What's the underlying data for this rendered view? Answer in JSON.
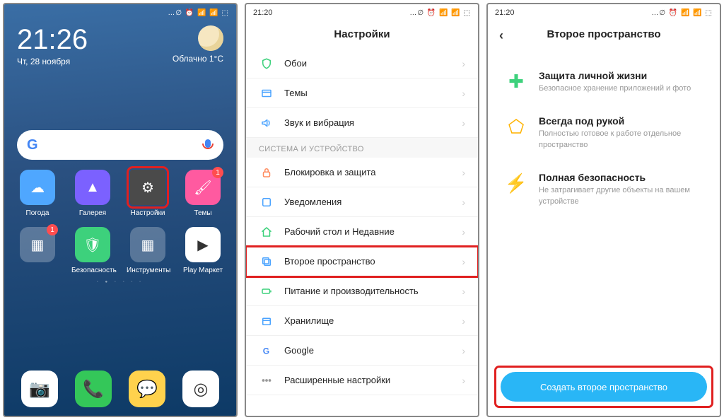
{
  "phone1": {
    "status": {
      "indicators": "…∅ ⏰ 📶 📶 ⬚"
    },
    "clock": {
      "time": "21:26",
      "date": "Чт, 28 ноября"
    },
    "weather": {
      "cond": "Облачно",
      "temp": "1°C"
    },
    "apps_row1": [
      {
        "name": "weather-app",
        "label": "Погода",
        "bg": "#4fa7ff",
        "glyph": "☁"
      },
      {
        "name": "gallery-app",
        "label": "Галерея",
        "bg": "#7b61ff",
        "glyph": "▲"
      },
      {
        "name": "settings-app",
        "label": "Настройки",
        "bg": "#4a4a4a",
        "glyph": "⚙",
        "highlight": true
      },
      {
        "name": "themes-app",
        "label": "Темы",
        "bg": "#ff5aa0",
        "glyph": "🖌",
        "badge": "1"
      }
    ],
    "apps_row2": [
      {
        "name": "tools-folder",
        "label": "",
        "bg": "rgba(255,255,255,.25)",
        "glyph": "▦",
        "badge": "1"
      },
      {
        "name": "security-app",
        "label": "Безопасность",
        "bg": "#3dd17c",
        "glyph": "🛡"
      },
      {
        "name": "instruments-folder",
        "label": "Инструменты",
        "bg": "rgba(255,255,255,.25)",
        "glyph": "▦"
      },
      {
        "name": "play-store-app",
        "label": "Play Маркет",
        "bg": "#ffffff",
        "glyph": "▶"
      }
    ],
    "dock": [
      {
        "name": "camera-app",
        "bg": "#fff",
        "glyph": "📷"
      },
      {
        "name": "phone-app",
        "bg": "#34c759",
        "glyph": "📞"
      },
      {
        "name": "messages-app",
        "bg": "#ffd24d",
        "glyph": "💬"
      },
      {
        "name": "chrome-app",
        "bg": "#fff",
        "glyph": "◎"
      }
    ]
  },
  "phone2": {
    "status": {
      "time": "21:20",
      "indicators": "…∅ ⏰ 📶 📶 ⬚"
    },
    "title": "Настройки",
    "section_label": "СИСТЕМА И УСТРОЙСТВО",
    "items_top": [
      {
        "name": "wallpaper-item",
        "label": "Обои",
        "color": "#3dd17c",
        "glyph": "shield"
      },
      {
        "name": "themes-item",
        "label": "Темы",
        "color": "#4aa3ff",
        "glyph": "frame"
      },
      {
        "name": "sound-item",
        "label": "Звук и вибрация",
        "color": "#4aa3ff",
        "glyph": "sound"
      }
    ],
    "items_mid": [
      {
        "name": "lock-security-item",
        "label": "Блокировка и защита",
        "color": "#ff8a5c",
        "glyph": "lock"
      },
      {
        "name": "notifications-item",
        "label": "Уведомления",
        "color": "#4aa3ff",
        "glyph": "square"
      },
      {
        "name": "home-recents-item",
        "label": "Рабочий стол и Недавние",
        "color": "#3dd17c",
        "glyph": "home"
      },
      {
        "name": "second-space-item",
        "label": "Второе пространство",
        "color": "#4aa3ff",
        "glyph": "copy",
        "highlight": true
      },
      {
        "name": "battery-perf-item",
        "label": "Питание и производительность",
        "color": "#3dd17c",
        "glyph": "batt"
      },
      {
        "name": "storage-item",
        "label": "Хранилище",
        "color": "#4aa3ff",
        "glyph": "box"
      },
      {
        "name": "google-item",
        "label": "Google",
        "color": "#4285f4",
        "glyph": "g"
      },
      {
        "name": "advanced-item",
        "label": "Расширенные настройки",
        "color": "#999",
        "glyph": "dots"
      }
    ]
  },
  "phone3": {
    "status": {
      "time": "21:20",
      "indicators": "…∅ ⏰ 📶 📶 ⬚"
    },
    "title": "Второе пространство",
    "features": [
      {
        "name": "privacy-feature",
        "title": "Защита личной жизни",
        "desc": "Безопасное хранение приложений и фото",
        "color": "#3dd17c",
        "glyph": "✚"
      },
      {
        "name": "handy-feature",
        "title": "Всегда под рукой",
        "desc": "Полностью готовое к работе отдельное пространство",
        "color": "#ffb300",
        "glyph": "⬠"
      },
      {
        "name": "security-feature",
        "title": "Полная безопасность",
        "desc": "Не затрагивает другие объекты на вашем устройстве",
        "color": "#29b6f6",
        "glyph": "⚡"
      }
    ],
    "create_button": "Создать второе пространство"
  }
}
